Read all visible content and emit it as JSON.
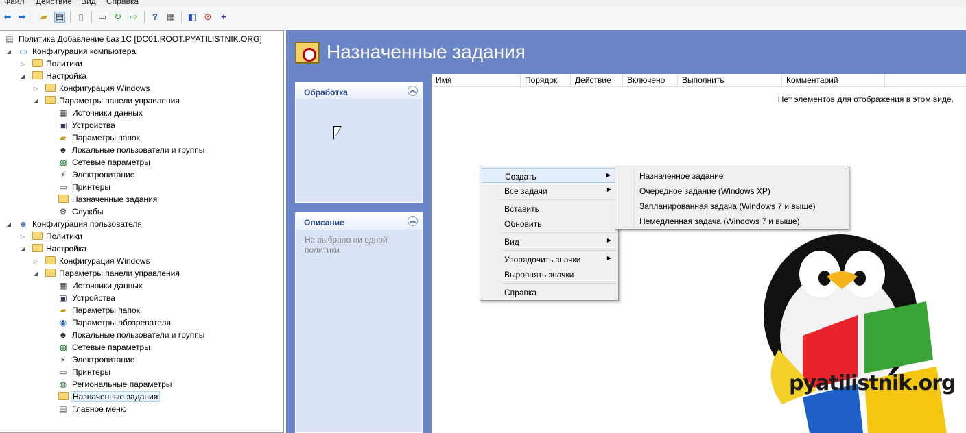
{
  "menubar": [
    "Файл",
    "Действие",
    "Вид",
    "Справка"
  ],
  "tree": {
    "root": "Политика Добавление баз 1С [DC01.ROOT.PYATILISTNIK.ORG]",
    "computer": "Конфигурация компьютера",
    "c_policies": "Политики",
    "c_settings": "Настройка",
    "c_win": "Конфигурация Windows",
    "c_cp": "Параметры панели управления",
    "c_items": [
      "Источники данных",
      "Устройства",
      "Параметры папок",
      "Локальные пользователи и группы",
      "Сетевые параметры",
      "Электропитание",
      "Принтеры",
      "Назначенные задания",
      "Службы"
    ],
    "user": "Конфигурация пользователя",
    "u_policies": "Политики",
    "u_settings": "Настройка",
    "u_win": "Конфигурация Windows",
    "u_cp": "Параметры панели управления",
    "u_items": [
      "Источники данных",
      "Устройства",
      "Параметры папок",
      "Параметры обозревателя",
      "Локальные пользователи и группы",
      "Сетевые параметры",
      "Электропитание",
      "Принтеры",
      "Региональные параметры",
      "Назначенные задания",
      "Главное меню"
    ]
  },
  "panel": {
    "title": "Назначенные задания",
    "processing": "Обработка",
    "description": "Описание",
    "desc_text": "Не выбрано ни одной политики"
  },
  "list": {
    "columns": [
      "Имя",
      "Порядок",
      "Действие",
      "Включено",
      "Выполнить",
      "Комментарий"
    ],
    "empty": "Нет элементов для отображения в этом виде."
  },
  "context_menu": {
    "items": [
      "Создать",
      "Все задачи",
      "Вставить",
      "Обновить",
      "Вид",
      "Упорядочить значки",
      "Выровнять значки",
      "Справка"
    ]
  },
  "submenu": {
    "items": [
      "Назначенное задание",
      "Очередное задание (Windows XP)",
      "Запланированная задача (Windows 7 и выше)",
      "Немедленная задача (Windows 7 и выше)"
    ]
  },
  "watermark": "pyatilistnik.org",
  "colors": {
    "panel_bg": "#6a86c8",
    "task_bg": "#dae2f5",
    "menu_bg": "#f0f0f0"
  }
}
